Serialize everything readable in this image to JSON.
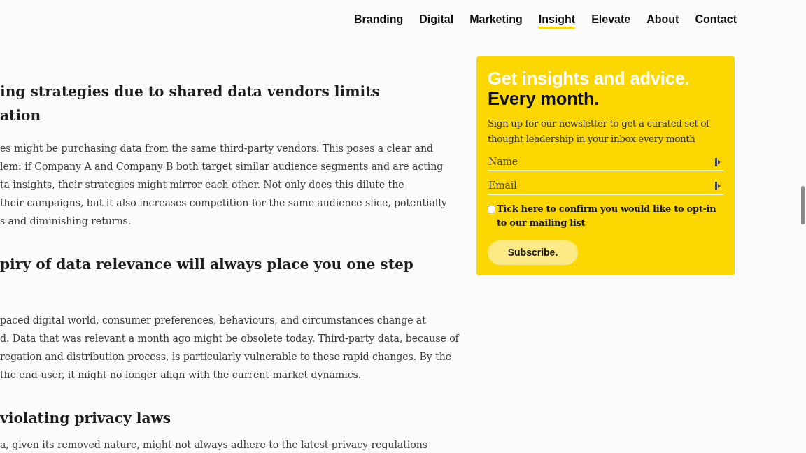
{
  "nav": {
    "items": [
      {
        "label": "Branding",
        "selected": false
      },
      {
        "label": "Digital",
        "selected": false
      },
      {
        "label": "Marketing",
        "selected": false
      },
      {
        "label": "Insight",
        "selected": true
      },
      {
        "label": "Elevate",
        "selected": false
      },
      {
        "label": "About",
        "selected": false
      },
      {
        "label": "Contact",
        "selected": false
      }
    ]
  },
  "article": {
    "blocks": [
      {
        "kind": "heading",
        "lines": [
          "ing strategies due to shared data vendors limits",
          "ation"
        ]
      },
      {
        "kind": "paragraph",
        "lines": [
          "es might be purchasing data from the same third-party vendors. This poses a clear and",
          "lem: if Company A and Company B both target similar audience segments and are acting",
          "ta insights, their strategies might mirror each other. Not only does this dilute the",
          "their campaigns, but it also increases competition for the same audience slice, potentially",
          "s and diminishing returns."
        ]
      },
      {
        "kind": "heading",
        "lines": [
          "piry of data relevance will always place you one step"
        ]
      },
      {
        "kind": "paragraph",
        "lines": [
          "paced digital world, consumer preferences, behaviours, and circumstances change at",
          "d. Data that was relevant a month ago might be obsolete today. Third-party data, because of",
          "regation and distribution process, is particularly vulnerable to these rapid changes. By the",
          "the end-user, it might no longer align with the current market dynamics."
        ]
      },
      {
        "kind": "heading",
        "lines": [
          "violating privacy laws"
        ]
      },
      {
        "kind": "paragraph",
        "lines": [
          "a, given its removed nature, might not always adhere to the latest privacy regulations"
        ]
      }
    ]
  },
  "newsletter": {
    "title_line_1": "Get insights and advice.",
    "title_line_2": "Every month.",
    "description": "Sign up for our newsletter to get a curated set of thought leadership in your inbox every month",
    "fields": [
      {
        "placeholder": "Name"
      },
      {
        "placeholder": "Email"
      }
    ],
    "consent": {
      "label": "Tick here to confirm you would like to opt-in to our mailing list",
      "checked": false
    },
    "button": "Subscribe."
  }
}
